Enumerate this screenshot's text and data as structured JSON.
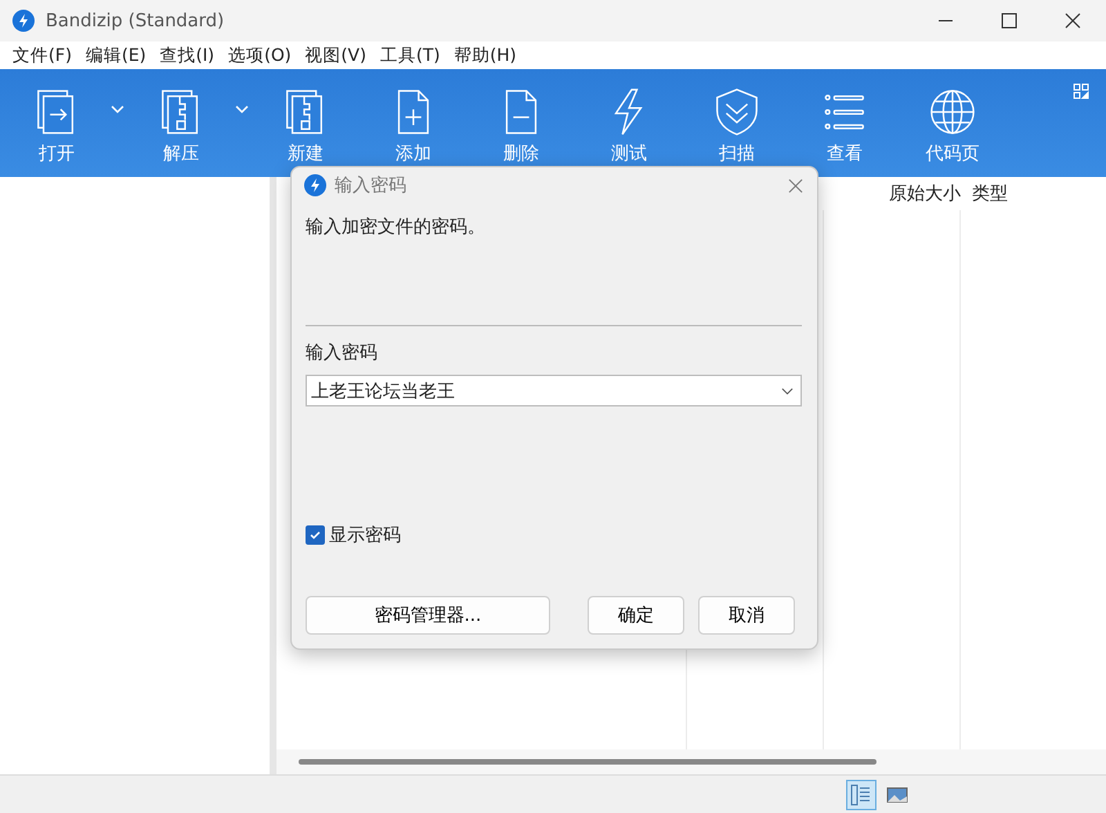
{
  "window": {
    "title": "Bandizip (Standard)"
  },
  "menu": [
    "文件(F)",
    "编辑(E)",
    "查找(I)",
    "选项(O)",
    "视图(V)",
    "工具(T)",
    "帮助(H)"
  ],
  "toolbar": [
    {
      "label": "打开",
      "kind": "open",
      "dropdown": true
    },
    {
      "label": "解压",
      "kind": "extract",
      "dropdown": true
    },
    {
      "label": "新建",
      "kind": "new"
    },
    {
      "label": "添加",
      "kind": "add"
    },
    {
      "label": "删除",
      "kind": "delete"
    },
    {
      "label": "测试",
      "kind": "test"
    },
    {
      "label": "扫描",
      "kind": "scan"
    },
    {
      "label": "查看",
      "kind": "view"
    },
    {
      "label": "代码页",
      "kind": "codepage"
    }
  ],
  "table": {
    "columns": [
      "原始大小",
      "类型"
    ]
  },
  "dialog": {
    "title": "输入密码",
    "message": "输入加密文件的密码。",
    "field_label": "输入密码",
    "password": "上老王论坛当老王",
    "show_password": {
      "label": "显示密码",
      "checked": true
    },
    "buttons": [
      "密码管理器...",
      "确定",
      "取消"
    ]
  },
  "status_bar": {
    "views": [
      {
        "kind": "details",
        "selected": true
      },
      {
        "kind": "preview",
        "selected": false
      }
    ]
  }
}
